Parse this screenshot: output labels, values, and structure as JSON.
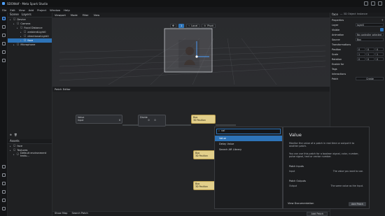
{
  "window": {
    "title": "SDOWolf - Meta Spark Studio"
  },
  "menu": [
    "File",
    "Edit",
    "View",
    "Add",
    "Project",
    "Window",
    "Help"
  ],
  "scene_panel": {
    "tabs": [
      "Scene",
      "Layers"
    ],
    "items": [
      {
        "label": "Device",
        "indent": 0,
        "selected": false
      },
      {
        "label": "Camera",
        "indent": 1,
        "selected": false
      },
      {
        "label": "Focal Distance",
        "indent": 2,
        "selected": false
      },
      {
        "label": "ambientLight0",
        "indent": 3,
        "selected": false
      },
      {
        "label": "directionalLight0",
        "indent": 3,
        "selected": false
      },
      {
        "label": "face",
        "indent": 3,
        "selected": true
      },
      {
        "label": "Microphone",
        "indent": 1,
        "selected": false
      }
    ]
  },
  "assets_panel": {
    "title": "Assets",
    "items": [
      {
        "label": "face",
        "indent": 0
      },
      {
        "label": "Textures",
        "indent": 0
      },
      {
        "label": "Default environment textu...",
        "indent": 1
      }
    ]
  },
  "viewport": {
    "tabs": [
      "Viewport",
      "Mode",
      "Filter",
      "View"
    ],
    "controls": [
      "1",
      "Local",
      "Pivot"
    ],
    "status": "Camera: Front | Near: User (Overlay)"
  },
  "preview": {
    "label": "User (Stan...",
    "controls": [
      "◀",
      "▶",
      "❚❚"
    ]
  },
  "right_panel": {
    "title": "face",
    "subtitle": "— 3D Object Instance",
    "sections": [
      {
        "name": "Properties"
      },
      {
        "name": "Transformations"
      },
      {
        "name": "Tags"
      },
      {
        "name": "Interactions"
      }
    ],
    "properties": {
      "layer_label": "Layer",
      "layer_value": "layer0",
      "visible_label": "Visible",
      "animation_label": "Animation",
      "animation_value": "No controller selected",
      "source_label": "Source",
      "source_value": "Box"
    },
    "transform": {
      "position_label": "Position",
      "scale_label": "Scale",
      "rotation_label": "Rotation",
      "position": [
        "0",
        "0",
        "0"
      ],
      "scale": [
        "1",
        "1",
        "1"
      ],
      "rotation": [
        "0",
        "0",
        "0"
      ]
    },
    "enable_for_label": "Enable for",
    "patch_label": "Patch",
    "create_label": "Create"
  },
  "patch_editor": {
    "title": "Patch Editor",
    "nodes": {
      "value": {
        "title": "Value",
        "input": "Input",
        "output": "0"
      },
      "divide": {
        "title": "Divide",
        "a": "0",
        "b": "0"
      },
      "box1": {
        "title": "Box",
        "port": "3D Position"
      },
      "box2": {
        "title": "Box",
        "port": "3D Position"
      },
      "box3": {
        "title": "Box",
        "port": "3D Position"
      }
    },
    "bottom_left": [
      "Show Map",
      "Search Patch"
    ],
    "add_patch_label": "Add Patch"
  },
  "search_popup": {
    "query": "val",
    "items": [
      {
        "label": "Value",
        "selected": true
      },
      {
        "label": "Delay Value",
        "selected": false
      },
      {
        "label": "Search AR Library",
        "selected": false
      }
    ]
  },
  "doc_panel": {
    "title": "Value",
    "desc1": "Monitor the value of a patch in real time or output it to another patch.",
    "desc2": "You can use this patch for a boolean signal, color, number, pulse signal, text or vector number.",
    "inputs_title": "Patch Inputs",
    "inputs": [
      {
        "k": "Input",
        "v": "The value you want to use."
      }
    ],
    "outputs_title": "Patch Outputs",
    "outputs": [
      {
        "k": "Output",
        "v": "The same value as the Input."
      }
    ],
    "footer_left": "View Documentation",
    "footer_right": "Add Patch"
  },
  "colors": {
    "accent": "#2d73b7",
    "node_yellow": "#e2cf8a"
  }
}
